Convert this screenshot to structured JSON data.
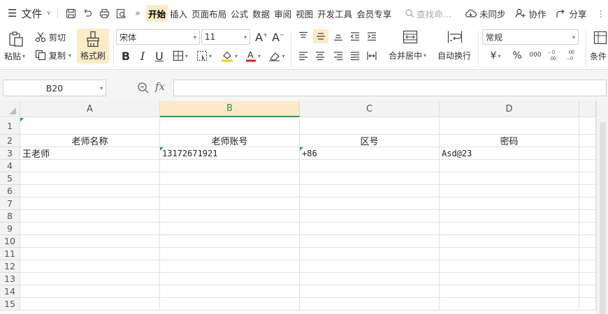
{
  "menubar": {
    "file_label": "文件",
    "tabs": [
      "开始",
      "插入",
      "页面布局",
      "公式",
      "数据",
      "审阅",
      "视图",
      "开发工具",
      "会员专享"
    ],
    "active_tab": 0,
    "search_placeholder": "查找命...",
    "sync_label": "未同步",
    "collab_label": "协作",
    "share_label": "分享"
  },
  "ribbon": {
    "cut_label": "剪切",
    "paste_label": "粘贴",
    "copy_label": "复制",
    "format_painter_label": "格式刷",
    "font_name": "宋体",
    "font_size": "11",
    "merge_label": "合并居中",
    "wrap_label": "自动换行",
    "number_format": "常规",
    "currency_symbol": "¥",
    "percent_symbol": "%",
    "thousands_symbol": "000",
    "conditional_label": "条件"
  },
  "formula_bar": {
    "name_box": "B20",
    "fx_label": "fx",
    "formula": ""
  },
  "sheet": {
    "columns": [
      "A",
      "B",
      "C",
      "D"
    ],
    "selected_column": "B",
    "rows": [
      "1",
      "2",
      "3",
      "4",
      "5",
      "6",
      "7",
      "8",
      "9",
      "10",
      "11",
      "12",
      "13",
      "14",
      "15"
    ],
    "header_row": [
      "老师名称",
      "老师账号",
      "区号",
      "密码"
    ],
    "data_row": [
      "王老师",
      "13172671921",
      "+86",
      "Asd@23"
    ]
  },
  "colors": {
    "accent_green": "#1e9a5a",
    "active_highlight": "#fdebc6",
    "font_color_red": "#e02020",
    "fill_color_yellow": "#f5d000"
  }
}
